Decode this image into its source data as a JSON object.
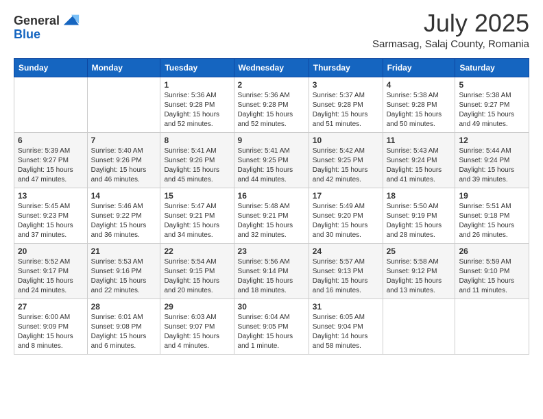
{
  "logo": {
    "general": "General",
    "blue": "Blue"
  },
  "title": "July 2025",
  "location": "Sarmasag, Salaj County, Romania",
  "weekdays": [
    "Sunday",
    "Monday",
    "Tuesday",
    "Wednesday",
    "Thursday",
    "Friday",
    "Saturday"
  ],
  "weeks": [
    [
      {
        "day": "",
        "info": ""
      },
      {
        "day": "",
        "info": ""
      },
      {
        "day": "1",
        "info": "Sunrise: 5:36 AM\nSunset: 9:28 PM\nDaylight: 15 hours and 52 minutes."
      },
      {
        "day": "2",
        "info": "Sunrise: 5:36 AM\nSunset: 9:28 PM\nDaylight: 15 hours and 52 minutes."
      },
      {
        "day": "3",
        "info": "Sunrise: 5:37 AM\nSunset: 9:28 PM\nDaylight: 15 hours and 51 minutes."
      },
      {
        "day": "4",
        "info": "Sunrise: 5:38 AM\nSunset: 9:28 PM\nDaylight: 15 hours and 50 minutes."
      },
      {
        "day": "5",
        "info": "Sunrise: 5:38 AM\nSunset: 9:27 PM\nDaylight: 15 hours and 49 minutes."
      }
    ],
    [
      {
        "day": "6",
        "info": "Sunrise: 5:39 AM\nSunset: 9:27 PM\nDaylight: 15 hours and 47 minutes."
      },
      {
        "day": "7",
        "info": "Sunrise: 5:40 AM\nSunset: 9:26 PM\nDaylight: 15 hours and 46 minutes."
      },
      {
        "day": "8",
        "info": "Sunrise: 5:41 AM\nSunset: 9:26 PM\nDaylight: 15 hours and 45 minutes."
      },
      {
        "day": "9",
        "info": "Sunrise: 5:41 AM\nSunset: 9:25 PM\nDaylight: 15 hours and 44 minutes."
      },
      {
        "day": "10",
        "info": "Sunrise: 5:42 AM\nSunset: 9:25 PM\nDaylight: 15 hours and 42 minutes."
      },
      {
        "day": "11",
        "info": "Sunrise: 5:43 AM\nSunset: 9:24 PM\nDaylight: 15 hours and 41 minutes."
      },
      {
        "day": "12",
        "info": "Sunrise: 5:44 AM\nSunset: 9:24 PM\nDaylight: 15 hours and 39 minutes."
      }
    ],
    [
      {
        "day": "13",
        "info": "Sunrise: 5:45 AM\nSunset: 9:23 PM\nDaylight: 15 hours and 37 minutes."
      },
      {
        "day": "14",
        "info": "Sunrise: 5:46 AM\nSunset: 9:22 PM\nDaylight: 15 hours and 36 minutes."
      },
      {
        "day": "15",
        "info": "Sunrise: 5:47 AM\nSunset: 9:21 PM\nDaylight: 15 hours and 34 minutes."
      },
      {
        "day": "16",
        "info": "Sunrise: 5:48 AM\nSunset: 9:21 PM\nDaylight: 15 hours and 32 minutes."
      },
      {
        "day": "17",
        "info": "Sunrise: 5:49 AM\nSunset: 9:20 PM\nDaylight: 15 hours and 30 minutes."
      },
      {
        "day": "18",
        "info": "Sunrise: 5:50 AM\nSunset: 9:19 PM\nDaylight: 15 hours and 28 minutes."
      },
      {
        "day": "19",
        "info": "Sunrise: 5:51 AM\nSunset: 9:18 PM\nDaylight: 15 hours and 26 minutes."
      }
    ],
    [
      {
        "day": "20",
        "info": "Sunrise: 5:52 AM\nSunset: 9:17 PM\nDaylight: 15 hours and 24 minutes."
      },
      {
        "day": "21",
        "info": "Sunrise: 5:53 AM\nSunset: 9:16 PM\nDaylight: 15 hours and 22 minutes."
      },
      {
        "day": "22",
        "info": "Sunrise: 5:54 AM\nSunset: 9:15 PM\nDaylight: 15 hours and 20 minutes."
      },
      {
        "day": "23",
        "info": "Sunrise: 5:56 AM\nSunset: 9:14 PM\nDaylight: 15 hours and 18 minutes."
      },
      {
        "day": "24",
        "info": "Sunrise: 5:57 AM\nSunset: 9:13 PM\nDaylight: 15 hours and 16 minutes."
      },
      {
        "day": "25",
        "info": "Sunrise: 5:58 AM\nSunset: 9:12 PM\nDaylight: 15 hours and 13 minutes."
      },
      {
        "day": "26",
        "info": "Sunrise: 5:59 AM\nSunset: 9:10 PM\nDaylight: 15 hours and 11 minutes."
      }
    ],
    [
      {
        "day": "27",
        "info": "Sunrise: 6:00 AM\nSunset: 9:09 PM\nDaylight: 15 hours and 8 minutes."
      },
      {
        "day": "28",
        "info": "Sunrise: 6:01 AM\nSunset: 9:08 PM\nDaylight: 15 hours and 6 minutes."
      },
      {
        "day": "29",
        "info": "Sunrise: 6:03 AM\nSunset: 9:07 PM\nDaylight: 15 hours and 4 minutes."
      },
      {
        "day": "30",
        "info": "Sunrise: 6:04 AM\nSunset: 9:05 PM\nDaylight: 15 hours and 1 minute."
      },
      {
        "day": "31",
        "info": "Sunrise: 6:05 AM\nSunset: 9:04 PM\nDaylight: 14 hours and 58 minutes."
      },
      {
        "day": "",
        "info": ""
      },
      {
        "day": "",
        "info": ""
      }
    ]
  ]
}
